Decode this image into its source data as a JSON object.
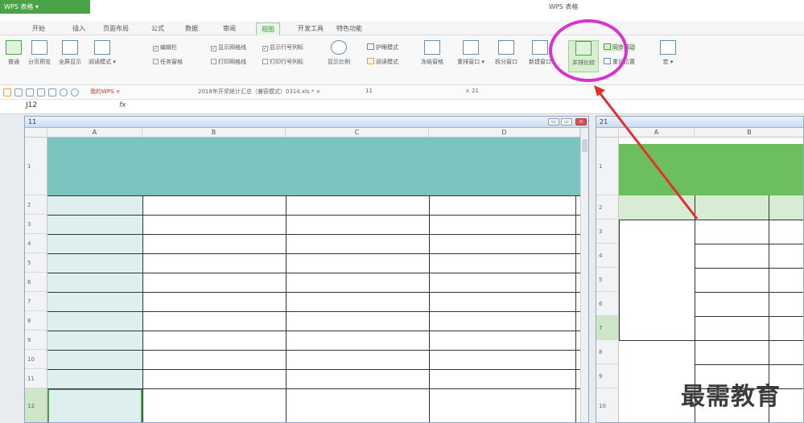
{
  "titlebar": {
    "app_button": "WPS 表格 ▾",
    "window_title": "WPS 表格"
  },
  "menu": {
    "items": [
      "开始",
      "插入",
      "页面布局",
      "公式",
      "数据",
      "审阅",
      "视图",
      "开发工具",
      "特色功能"
    ],
    "active_index": 6
  },
  "ribbon": {
    "buttons": [
      {
        "label": "普通",
        "green": true
      },
      {
        "label": "分页预览",
        "green": false
      },
      {
        "label": "全屏显示",
        "green": false
      },
      {
        "label": "阅读模式 ▾",
        "green": false
      },
      {
        "label": "显示比例",
        "green": false
      },
      {
        "label": "冻结窗格",
        "green": false
      },
      {
        "label": "重排窗口 ▾",
        "green": false
      },
      {
        "label": "拆分窗口",
        "green": false
      },
      {
        "label": "新建窗口",
        "green": false
      },
      {
        "label": "并排比较",
        "green": true,
        "highlight": true
      },
      {
        "label": "宏 ▾",
        "green": false
      }
    ],
    "checks": [
      {
        "label": "编辑栏",
        "checked": true
      },
      {
        "label": "任务窗格",
        "checked": false
      },
      {
        "label": "显示网格线",
        "checked": true
      },
      {
        "label": "打印网格线",
        "checked": false
      },
      {
        "label": "显示行号列标",
        "checked": true
      },
      {
        "label": "打印行号列标",
        "checked": false
      }
    ],
    "small_buttons": [
      {
        "label": "护眼模式"
      },
      {
        "label": "阅读模式"
      },
      {
        "label": "同步滚动"
      },
      {
        "label": "重设位置"
      }
    ]
  },
  "tabs": {
    "items": [
      "我的WPS ×",
      "2018年开奖统计汇总（兼容模式）0314.xls * ×",
      "11",
      "× 21"
    ]
  },
  "formula": {
    "namebox": "J12",
    "fx": "fx"
  },
  "left_window": {
    "title": "11",
    "columns": [
      "A",
      "B",
      "C",
      "D"
    ],
    "rows": [
      "1",
      "2",
      "3",
      "4",
      "5",
      "6",
      "7",
      "8",
      "9",
      "10",
      "11",
      "12"
    ],
    "selected_row": "12",
    "controls": [
      "▭",
      "▭",
      "✕"
    ]
  },
  "right_window": {
    "title": "21",
    "columns": [
      "A",
      "B"
    ],
    "rows": [
      "1",
      "2",
      "3",
      "4",
      "5",
      "6",
      "7",
      "8",
      "9",
      "10"
    ],
    "selected_row": "7"
  },
  "watermark": "最需教育",
  "colors": {
    "accent_green": "#4aa346",
    "teal_header": "#7cc4bf",
    "green_header": "#6cbe5f",
    "highlight_circle": "#d633d2",
    "arrow": "#e03131"
  }
}
